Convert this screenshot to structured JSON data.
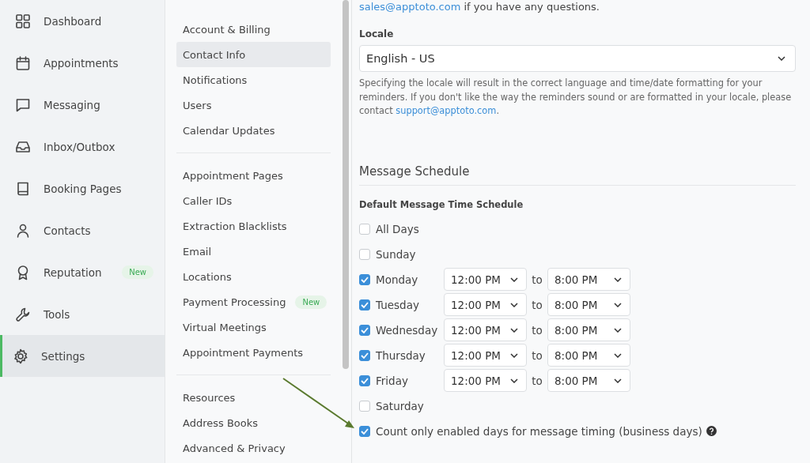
{
  "nav": [
    {
      "label": "Dashboard",
      "selected": false
    },
    {
      "label": "Appointments",
      "selected": false
    },
    {
      "label": "Messaging",
      "selected": false
    },
    {
      "label": "Inbox/Outbox",
      "selected": false
    },
    {
      "label": "Booking Pages",
      "selected": false
    },
    {
      "label": "Contacts",
      "selected": false
    },
    {
      "label": "Reputation",
      "selected": false,
      "badge": "New"
    },
    {
      "label": "Tools",
      "selected": false
    },
    {
      "label": "Settings",
      "selected": true
    }
  ],
  "settings_menu": [
    [
      {
        "label": "Account & Billing",
        "selected": false
      },
      {
        "label": "Contact Info",
        "selected": true
      },
      {
        "label": "Notifications",
        "selected": false
      },
      {
        "label": "Users",
        "selected": false
      },
      {
        "label": "Calendar Updates",
        "selected": false
      }
    ],
    [
      {
        "label": "Appointment Pages",
        "selected": false
      },
      {
        "label": "Caller IDs",
        "selected": false
      },
      {
        "label": "Extraction Blacklists",
        "selected": false
      },
      {
        "label": "Email",
        "selected": false
      },
      {
        "label": "Locations",
        "selected": false
      },
      {
        "label": "Payment Processing",
        "selected": false,
        "badge": "New"
      },
      {
        "label": "Virtual Meetings",
        "selected": false
      },
      {
        "label": "Appointment Payments",
        "selected": false
      }
    ],
    [
      {
        "label": "Resources",
        "selected": false
      },
      {
        "label": "Address Books",
        "selected": false
      },
      {
        "label": "Advanced & Privacy",
        "selected": false
      }
    ]
  ],
  "intro": {
    "link": "sales@apptoto.com",
    "text": " if you have any questions."
  },
  "locale": {
    "label": "Locale",
    "value": "English - US",
    "help": "Specifying the locale will result in the correct language and time/date formatting for your reminders. If you don't like the way the reminders sound or are formatted in your locale, please contact ",
    "help_link": "support@apptoto.com",
    "help_end": "."
  },
  "schedule": {
    "title": "Message Schedule",
    "subtitle": "Default Message Time Schedule",
    "days": [
      {
        "label": "All Days",
        "checked": false
      },
      {
        "label": "Sunday",
        "checked": false
      },
      {
        "label": "Monday",
        "checked": true,
        "start": "12:00 PM",
        "separator": "to",
        "end": "8:00 PM"
      },
      {
        "label": "Tuesday",
        "checked": true,
        "start": "12:00 PM",
        "separator": "to",
        "end": "8:00 PM"
      },
      {
        "label": "Wednesday",
        "checked": true,
        "start": "12:00 PM",
        "separator": "to",
        "end": "8:00 PM"
      },
      {
        "label": "Thursday",
        "checked": true,
        "start": "12:00 PM",
        "separator": "to",
        "end": "8:00 PM"
      },
      {
        "label": "Friday",
        "checked": true,
        "start": "12:00 PM",
        "separator": "to",
        "end": "8:00 PM"
      },
      {
        "label": "Saturday",
        "checked": false
      }
    ],
    "business_days": {
      "label": "Count only enabled days for message timing (business days)",
      "checked": true
    }
  }
}
